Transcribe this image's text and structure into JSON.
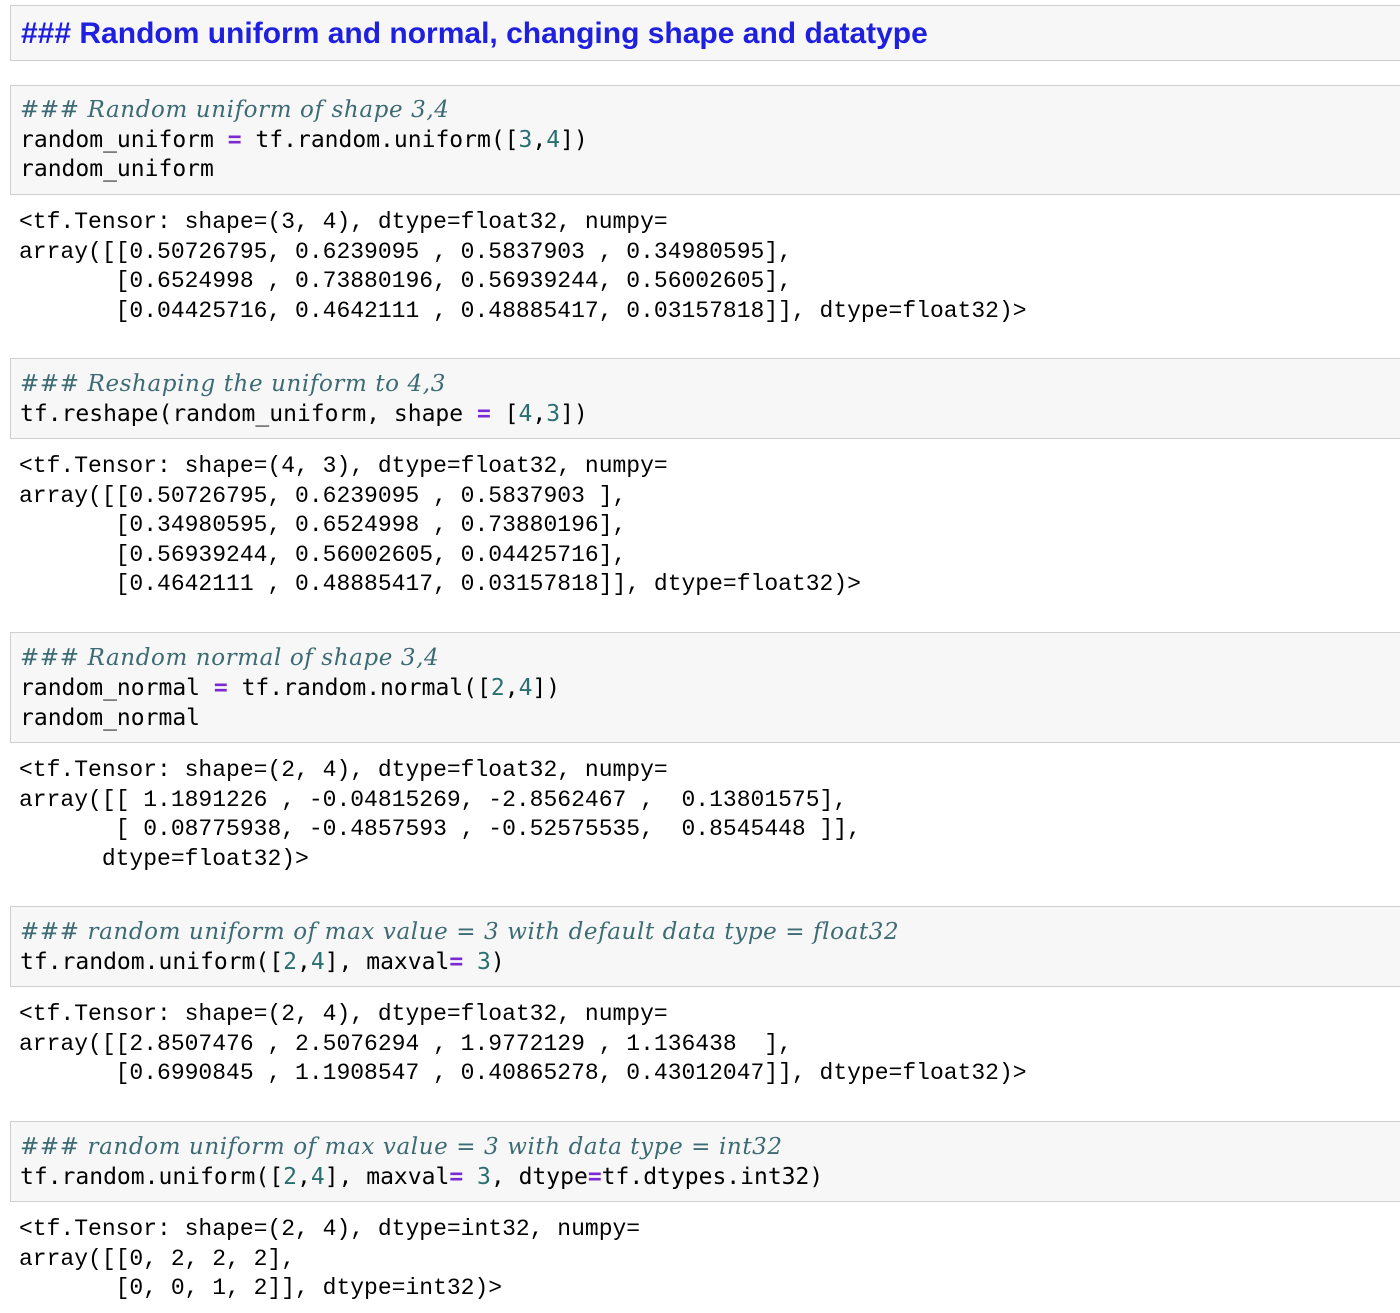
{
  "heading": "### Random uniform and normal, changing shape and datatype",
  "cells": [
    {
      "comment": "### Random uniform of shape 3,4",
      "line2": {
        "pre": "random_uniform ",
        "op": "=",
        "mid": " tf.random.uniform([",
        "n1": "3",
        "sep": ",",
        "n2": "4",
        "post": "])"
      },
      "line3": "random_uniform",
      "output": "<tf.Tensor: shape=(3, 4), dtype=float32, numpy=\narray([[0.50726795, 0.6239095 , 0.5837903 , 0.34980595],\n       [0.6524998 , 0.73880196, 0.56939244, 0.56002605],\n       [0.04425716, 0.4642111 , 0.48885417, 0.03157818]], dtype=float32)>"
    },
    {
      "comment": "### Reshaping the uniform to 4,3",
      "line2": {
        "pre": "tf.reshape(random_uniform, shape ",
        "op": "=",
        "mid": " [",
        "n1": "4",
        "sep": ",",
        "n2": "3",
        "post": "])"
      },
      "output": "<tf.Tensor: shape=(4, 3), dtype=float32, numpy=\narray([[0.50726795, 0.6239095 , 0.5837903 ],\n       [0.34980595, 0.6524998 , 0.73880196],\n       [0.56939244, 0.56002605, 0.04425716],\n       [0.4642111 , 0.48885417, 0.03157818]], dtype=float32)>"
    },
    {
      "comment": "### Random normal of shape 3,4",
      "line2": {
        "pre": "random_normal ",
        "op": "=",
        "mid": " tf.random.normal([",
        "n1": "2",
        "sep": ",",
        "n2": "4",
        "post": "])"
      },
      "line3": "random_normal",
      "output": "<tf.Tensor: shape=(2, 4), dtype=float32, numpy=\narray([[ 1.1891226 , -0.04815269, -2.8562467 ,  0.13801575],\n       [ 0.08775938, -0.4857593 , -0.52575535,  0.8545448 ]],\n      dtype=float32)>"
    },
    {
      "comment": "### random uniform of max value = 3 with default data type = float32",
      "line2": {
        "pre": "tf.random.uniform([",
        "n1": "2",
        "sep": ",",
        "n2": "4",
        "mid": "], maxval",
        "op": "=",
        "n3": " 3",
        "post": ")"
      },
      "output": "<tf.Tensor: shape=(2, 4), dtype=float32, numpy=\narray([[2.8507476 , 2.5076294 , 1.9772129 , 1.136438  ],\n       [0.6990845 , 1.1908547 , 0.40865278, 0.43012047]], dtype=float32)>"
    },
    {
      "comment": "### random uniform of max value = 3 with data type = int32",
      "line2": {
        "pre": "tf.random.uniform([",
        "n1": "2",
        "sep": ",",
        "n2": "4",
        "mid": "], maxval",
        "op": "=",
        "n3": " 3",
        "mid2": ", dtype",
        "op2": "=",
        "post": "tf.dtypes.int32)"
      },
      "output": "<tf.Tensor: shape=(2, 4), dtype=int32, numpy=\narray([[0, 2, 2, 2],\n       [0, 0, 1, 2]], dtype=int32)>"
    }
  ]
}
